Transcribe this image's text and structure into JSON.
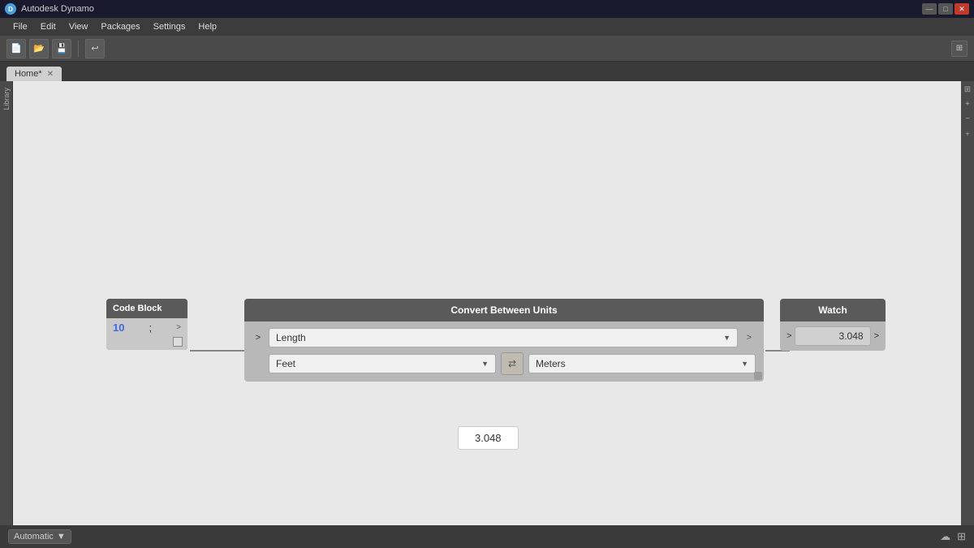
{
  "app": {
    "title": "Autodesk Dynamo",
    "logo_char": "D"
  },
  "title_bar": {
    "text": "Autodesk Dynamo",
    "controls": {
      "minimize": "—",
      "maximize": "□",
      "close": "✕"
    }
  },
  "menu_bar": {
    "items": [
      "File",
      "Edit",
      "View",
      "Packages",
      "Settings",
      "Help"
    ]
  },
  "toolbar": {
    "buttons": [
      "📄",
      "📂",
      "💾",
      "↩"
    ],
    "right_button": "⊞"
  },
  "tab_bar": {
    "active_tab": "Home*",
    "close_char": "✕"
  },
  "sidebar": {
    "label": "Library"
  },
  "canvas": {
    "background": "#e8e8e8"
  },
  "code_block_node": {
    "title": "Code Block",
    "code_value": "10",
    "code_suffix": ";",
    "output_port": ">",
    "port_out_char": ">"
  },
  "convert_node": {
    "title": "Convert Between Units",
    "input_port": ">",
    "output_port": ">",
    "length_label": "Length",
    "from_unit": "Feet",
    "to_unit": "Meters",
    "swap_char": "⇄"
  },
  "watch_node": {
    "title": "Watch",
    "input_port": ">",
    "output_port": ">",
    "value": "3.048"
  },
  "result_bubble": {
    "value": "3.048"
  },
  "bottom_bar": {
    "mode": "Automatic",
    "dropdown_arrow": "▼",
    "icon1": "☁",
    "icon2": "⊞"
  },
  "right_panel": {
    "zoom_in": "+",
    "zoom_out": "−",
    "fit": "⊕",
    "reset": "×"
  },
  "colors": {
    "node_header": "#5a5a5a",
    "node_body_dark": "#b8b8b8",
    "node_body_light": "#c8c8c8",
    "canvas_bg": "#e8e8e8",
    "code_blue": "#4169e1",
    "connection_line": "#888888"
  }
}
